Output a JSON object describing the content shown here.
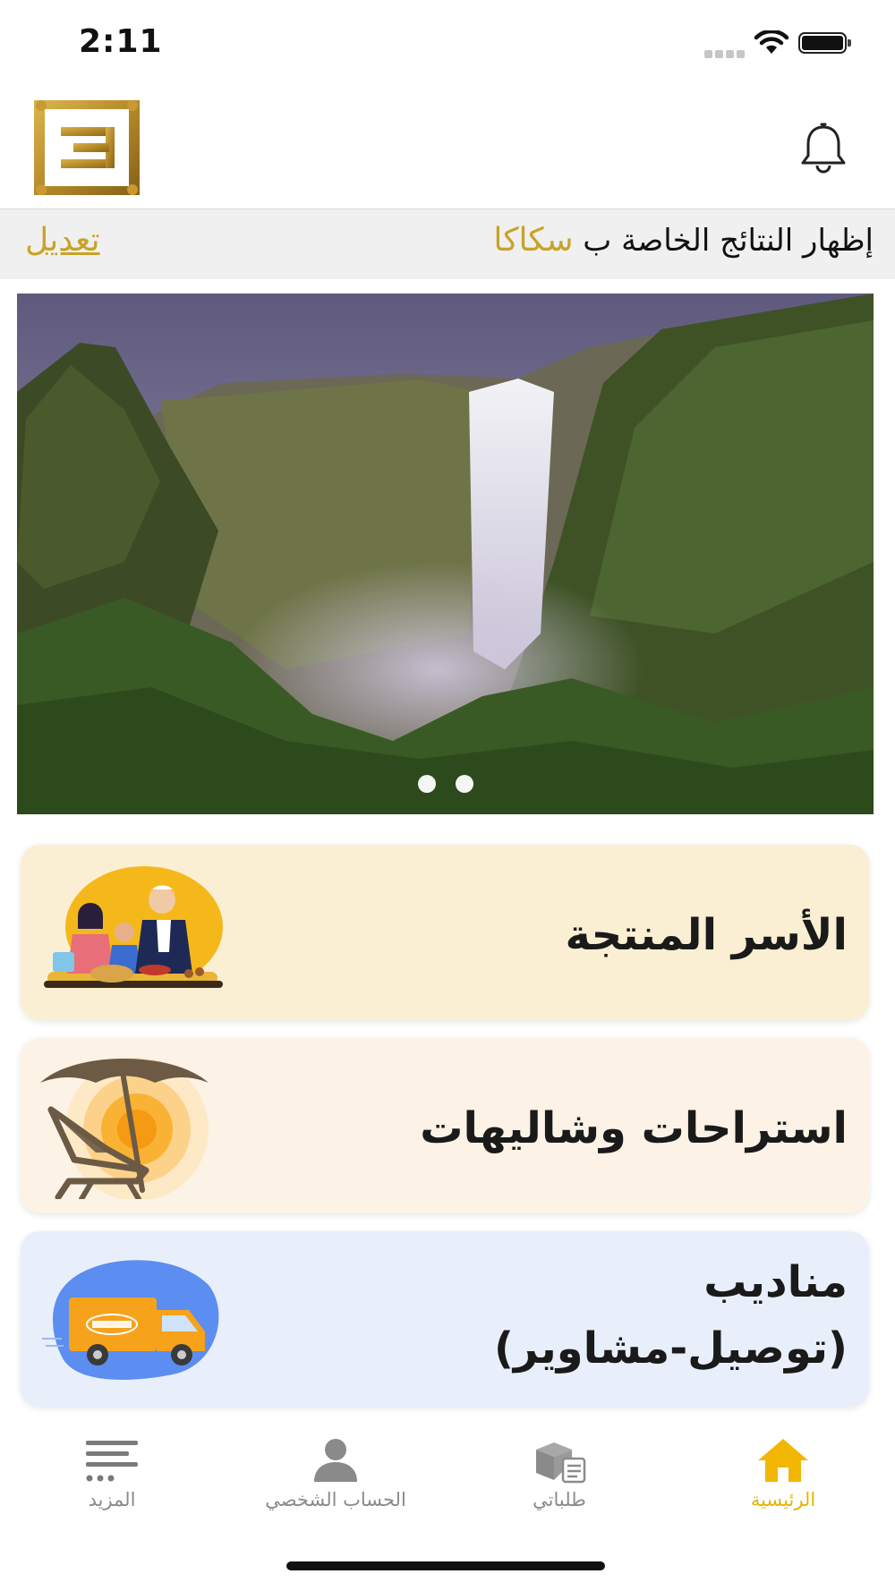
{
  "status_bar": {
    "time": "2:11"
  },
  "header": {
    "logo_icon": "brand-logo",
    "notification_icon": "bell-icon"
  },
  "location_bar": {
    "prefix": "إظهار النتائج الخاصة ب",
    "city": "سكاكا",
    "edit_label": "تعديل",
    "accent_color": "#c9a227"
  },
  "banner": {
    "image": "waterfall-landscape",
    "slide_count": 2
  },
  "categories": [
    {
      "label": "الأسر المنتجة",
      "icon": "family-cooking-illustration",
      "bg": "#fbefd3"
    },
    {
      "label": "استراحات وشاليهات",
      "icon": "beach-umbrella-chair-illustration",
      "bg": "#fcf3e6"
    },
    {
      "label_line1": "مناديب",
      "label_line2": "(توصيل-مشاوير)",
      "icon": "delivery-van-illustration",
      "bg": "#e8effb"
    }
  ],
  "bottom_nav": {
    "items": [
      {
        "label": "المزيد",
        "icon": "menu-more-icon"
      },
      {
        "label": "الحساب الشخصي",
        "icon": "person-icon"
      },
      {
        "label": "طلباتي",
        "icon": "orders-box-icon"
      },
      {
        "label": "الرئيسية",
        "icon": "home-icon",
        "active": true
      }
    ],
    "active_color": "#e6b400"
  }
}
